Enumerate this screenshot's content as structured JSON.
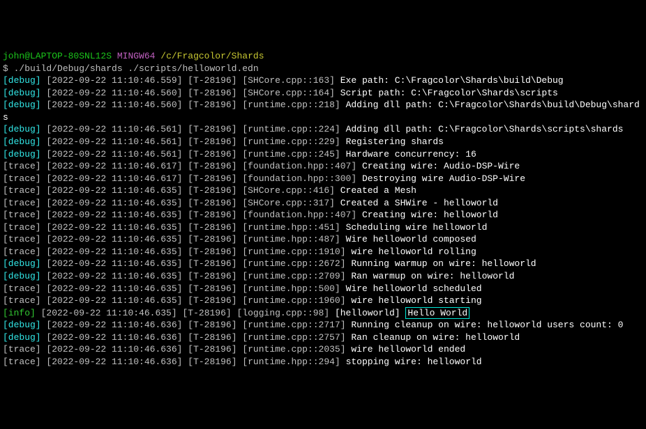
{
  "prompt": {
    "user": "john@LAPTOP-80SNL12S",
    "env": "MINGW64",
    "path": "/c/Fragcolor/Shards",
    "command": "$ ./build/Debug/shards ./scripts/helloworld.edn"
  },
  "lines": [
    {
      "level": "debug",
      "ts": "2022-09-22 11:10:46.559",
      "thread": "T-28196",
      "src": "SHCore.cpp::163",
      "msg": "Exe path: C:\\Fragcolor\\Shards\\build\\Debug"
    },
    {
      "level": "debug",
      "ts": "2022-09-22 11:10:46.560",
      "thread": "T-28196",
      "src": "SHCore.cpp::164",
      "msg": "Script path: C:\\Fragcolor\\Shards\\scripts"
    },
    {
      "level": "debug",
      "ts": "2022-09-22 11:10:46.560",
      "thread": "T-28196",
      "src": "runtime.cpp::218",
      "msg": "Adding dll path: C:\\Fragcolor\\Shards\\build\\Debug\\shards"
    },
    {
      "level": "debug",
      "ts": "2022-09-22 11:10:46.561",
      "thread": "T-28196",
      "src": "runtime.cpp::224",
      "msg": "Adding dll path: C:\\Fragcolor\\Shards\\scripts\\shards"
    },
    {
      "level": "debug",
      "ts": "2022-09-22 11:10:46.561",
      "thread": "T-28196",
      "src": "runtime.cpp::229",
      "msg": "Registering shards"
    },
    {
      "level": "debug",
      "ts": "2022-09-22 11:10:46.561",
      "thread": "T-28196",
      "src": "runtime.cpp::245",
      "msg": "Hardware concurrency: 16"
    },
    {
      "level": "trace",
      "ts": "2022-09-22 11:10:46.617",
      "thread": "T-28196",
      "src": "foundation.hpp::407",
      "msg": "Creating wire: Audio-DSP-Wire"
    },
    {
      "level": "trace",
      "ts": "2022-09-22 11:10:46.617",
      "thread": "T-28196",
      "src": "foundation.hpp::300",
      "msg": "Destroying wire Audio-DSP-Wire"
    },
    {
      "level": "trace",
      "ts": "2022-09-22 11:10:46.635",
      "thread": "T-28196",
      "src": "SHCore.cpp::416",
      "msg": "Created a Mesh"
    },
    {
      "level": "trace",
      "ts": "2022-09-22 11:10:46.635",
      "thread": "T-28196",
      "src": "SHCore.cpp::317",
      "msg": "Created a SHWire - helloworld"
    },
    {
      "level": "trace",
      "ts": "2022-09-22 11:10:46.635",
      "thread": "T-28196",
      "src": "foundation.hpp::407",
      "msg": "Creating wire: helloworld"
    },
    {
      "level": "trace",
      "ts": "2022-09-22 11:10:46.635",
      "thread": "T-28196",
      "src": "runtime.hpp::451",
      "msg": "Scheduling wire helloworld"
    },
    {
      "level": "trace",
      "ts": "2022-09-22 11:10:46.635",
      "thread": "T-28196",
      "src": "runtime.hpp::487",
      "msg": "Wire helloworld composed"
    },
    {
      "level": "trace",
      "ts": "2022-09-22 11:10:46.635",
      "thread": "T-28196",
      "src": "runtime.cpp::1910",
      "msg": "wire helloworld rolling"
    },
    {
      "level": "debug",
      "ts": "2022-09-22 11:10:46.635",
      "thread": "T-28196",
      "src": "runtime.cpp::2672",
      "msg": "Running warmup on wire: helloworld"
    },
    {
      "level": "debug",
      "ts": "2022-09-22 11:10:46.635",
      "thread": "T-28196",
      "src": "runtime.cpp::2709",
      "msg": "Ran warmup on wire: helloworld"
    },
    {
      "level": "trace",
      "ts": "2022-09-22 11:10:46.635",
      "thread": "T-28196",
      "src": "runtime.hpp::500",
      "msg": "Wire helloworld scheduled"
    },
    {
      "level": "trace",
      "ts": "2022-09-22 11:10:46.635",
      "thread": "T-28196",
      "src": "runtime.cpp::1960",
      "msg": "wire helloworld starting"
    },
    {
      "level": "info",
      "ts": "2022-09-22 11:10:46.635",
      "thread": "T-28196",
      "src": "logging.cpp::98",
      "tag": "helloworld",
      "msg": "Hello World",
      "highlight": true
    },
    {
      "level": "debug",
      "ts": "2022-09-22 11:10:46.636",
      "thread": "T-28196",
      "src": "runtime.cpp::2717",
      "msg": "Running cleanup on wire: helloworld users count: 0"
    },
    {
      "level": "debug",
      "ts": "2022-09-22 11:10:46.636",
      "thread": "T-28196",
      "src": "runtime.cpp::2757",
      "msg": "Ran cleanup on wire: helloworld"
    },
    {
      "level": "trace",
      "ts": "2022-09-22 11:10:46.636",
      "thread": "T-28196",
      "src": "runtime.cpp::2035",
      "msg": "wire helloworld ended"
    },
    {
      "level": "trace",
      "ts": "2022-09-22 11:10:46.636",
      "thread": "T-28196",
      "src": "runtime.hpp::294",
      "msg": "stopping wire: helloworld"
    }
  ]
}
